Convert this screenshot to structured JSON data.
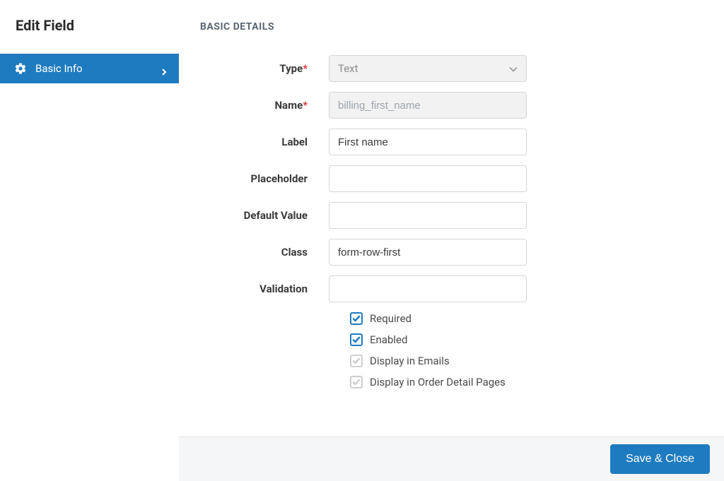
{
  "sidebar": {
    "title": "Edit Field",
    "item": {
      "label": "Basic Info"
    }
  },
  "section": {
    "title": "BASIC DETAILS"
  },
  "fields": {
    "type": {
      "label": "Type",
      "value": "Text"
    },
    "name": {
      "label": "Name",
      "placeholder": "billing_first_name"
    },
    "label_field": {
      "label": "Label",
      "value": "First name"
    },
    "placeholder": {
      "label": "Placeholder",
      "value": ""
    },
    "default_value": {
      "label": "Default Value",
      "value": ""
    },
    "class": {
      "label": "Class",
      "value": "form-row-first"
    },
    "validation": {
      "label": "Validation",
      "value": ""
    }
  },
  "checks": {
    "required": {
      "label": "Required"
    },
    "enabled": {
      "label": "Enabled"
    },
    "display_emails": {
      "label": "Display in Emails"
    },
    "display_order": {
      "label": "Display in Order Detail Pages"
    }
  },
  "footer": {
    "save": "Save & Close"
  }
}
